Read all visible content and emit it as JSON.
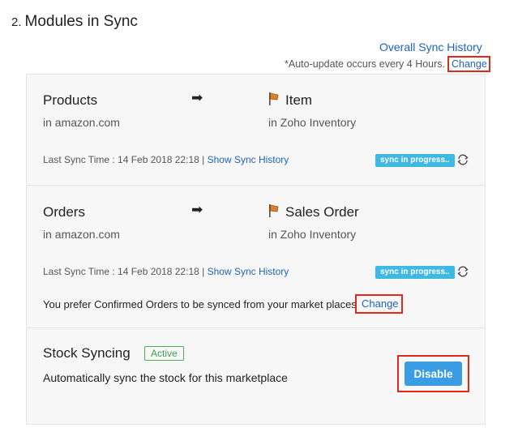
{
  "section": {
    "number": "2.",
    "title": "Modules in Sync"
  },
  "overall_sync_history_label": "Overall Sync History",
  "auto_update": {
    "text": "*Auto-update occurs every 4 Hours.",
    "change_label": "Change"
  },
  "modules": [
    {
      "source_name": "Products",
      "source_location": "in amazon.com",
      "arrow_icon": "arrow-right-icon",
      "target_icon": "zoho-item-icon",
      "target_name": "Item",
      "target_location": "in Zoho Inventory",
      "last_sync_label": "Last Sync Time : 14 Feb 2018 22:18 |",
      "show_history_label": "Show Sync History",
      "status_badge": "sync in progress..",
      "refresh_icon": "refresh-icon"
    },
    {
      "source_name": "Orders",
      "source_location": "in amazon.com",
      "arrow_icon": "arrow-right-icon",
      "target_icon": "zoho-item-icon",
      "target_name": "Sales Order",
      "target_location": "in Zoho Inventory",
      "last_sync_label": "Last Sync Time : 14 Feb 2018 22:18 |",
      "show_history_label": "Show Sync History",
      "status_badge": "sync in progress..",
      "refresh_icon": "refresh-icon"
    }
  ],
  "orders_preference": {
    "text": "You prefer Confirmed Orders to be synced from your market places",
    "change_label": "Change"
  },
  "stock": {
    "title": "Stock Syncing",
    "status": "Active",
    "description": "Automatically sync the stock for this marketplace",
    "disable_label": "Disable"
  },
  "colors": {
    "link": "#1f63b8",
    "highlight": "#e0281b",
    "badge": "#3fb9e2",
    "button": "#3a9de3",
    "active": "#3aa14a"
  }
}
